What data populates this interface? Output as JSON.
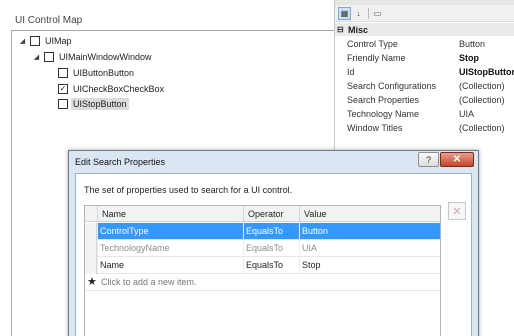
{
  "left_panel": {
    "title": "UI Control Map",
    "tree": [
      {
        "label": "UIMap",
        "expanded": true
      },
      {
        "label": "UIMainWindowWindow",
        "expanded": true
      },
      {
        "label": "UIButtonButton"
      },
      {
        "label": "UICheckBoxCheckBox",
        "checked": true
      },
      {
        "label": "UIStopButton",
        "selected": true
      }
    ]
  },
  "property_grid": {
    "category": "Misc",
    "properties": [
      {
        "name": "Control Type",
        "value": "Button"
      },
      {
        "name": "Friendly Name",
        "value": "Stop",
        "bold": true
      },
      {
        "name": "Id",
        "value": "UIStopButton",
        "bold": true
      },
      {
        "name": "Search Configurations",
        "value": "(Collection)"
      },
      {
        "name": "Search Properties",
        "value": "(Collection)"
      },
      {
        "name": "Technology Name",
        "value": "UIA"
      },
      {
        "name": "Window Titles",
        "value": "(Collection)"
      }
    ]
  },
  "dialog": {
    "title": "Edit Search Properties",
    "help_label": "?",
    "close_label": "✕",
    "description": "The set of properties used to search for a UI control.",
    "columns": [
      "Name",
      "Operator",
      "Value"
    ],
    "rows": [
      {
        "name": "ControlType",
        "operator": "EqualsTo",
        "value": "Button",
        "selected": true
      },
      {
        "name": "TechnologyName",
        "operator": "EqualsTo",
        "value": "UIA",
        "dim": true
      },
      {
        "name": "Name",
        "operator": "EqualsTo",
        "value": "Stop"
      }
    ],
    "new_row_text": "Click to add a new item.",
    "delete_label": "✕"
  },
  "colors": {
    "selection": "#3399ff",
    "dialog_frame": "#dbe6f3",
    "close_button": "#c7452c"
  }
}
